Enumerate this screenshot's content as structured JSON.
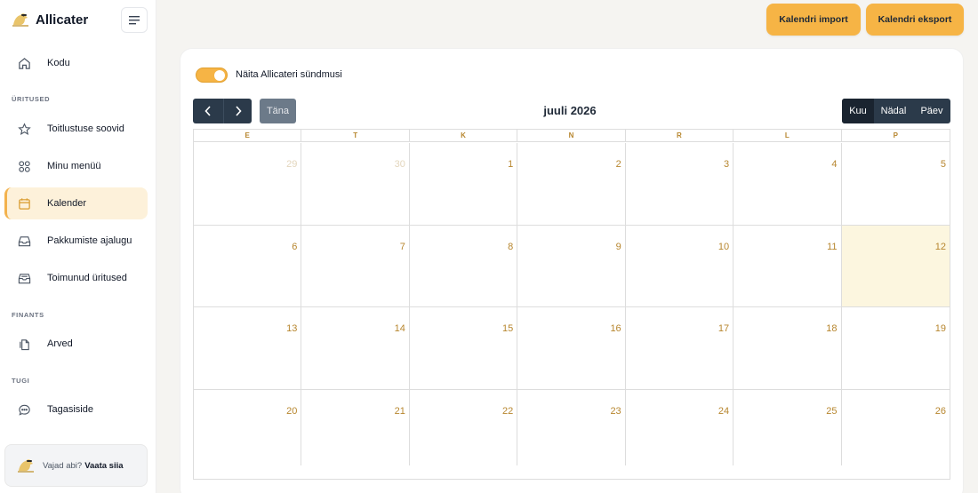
{
  "app": {
    "name": "Allicater"
  },
  "sidebar": {
    "home": {
      "label": "Kodu"
    },
    "sections": {
      "events": "ÜRITUSED",
      "finance": "FINANTS",
      "support": "TUGI"
    },
    "items": [
      {
        "label": "Toitlustuse soovid"
      },
      {
        "label": "Minu menüü"
      },
      {
        "label": "Kalender"
      },
      {
        "label": "Pakkumiste ajalugu"
      },
      {
        "label": "Toimunud üritused"
      },
      {
        "label": "Arved"
      },
      {
        "label": "Tagasiside"
      }
    ],
    "help": {
      "text": "Vajad abi?",
      "link": "Vaata siia"
    }
  },
  "header": {
    "import_label": "Kalendri import",
    "export_label": "Kalendri eksport"
  },
  "calendar": {
    "toggle_label": "Näita Allicateri sündmusi",
    "toggle_on": true,
    "today_label": "Täna",
    "title": "juuli 2026",
    "views": [
      "Kuu",
      "Nädal",
      "Päev"
    ],
    "active_view": "Kuu",
    "weekdays": [
      "E",
      "T",
      "K",
      "N",
      "R",
      "L",
      "P"
    ],
    "weeks": [
      [
        "29",
        "30",
        "1",
        "2",
        "3",
        "4",
        "5"
      ],
      [
        "6",
        "7",
        "8",
        "9",
        "10",
        "11",
        "12"
      ],
      [
        "13",
        "14",
        "15",
        "16",
        "17",
        "18",
        "19"
      ],
      [
        "20",
        "21",
        "22",
        "23",
        "24",
        "25",
        "26"
      ]
    ],
    "today": "12"
  },
  "colors": {
    "accent": "#f6b445",
    "active_bg": "#fdf1da",
    "dark_button": "#2b3a4a",
    "day_number": "#b7862e",
    "today_bg": "#fcf6df"
  }
}
